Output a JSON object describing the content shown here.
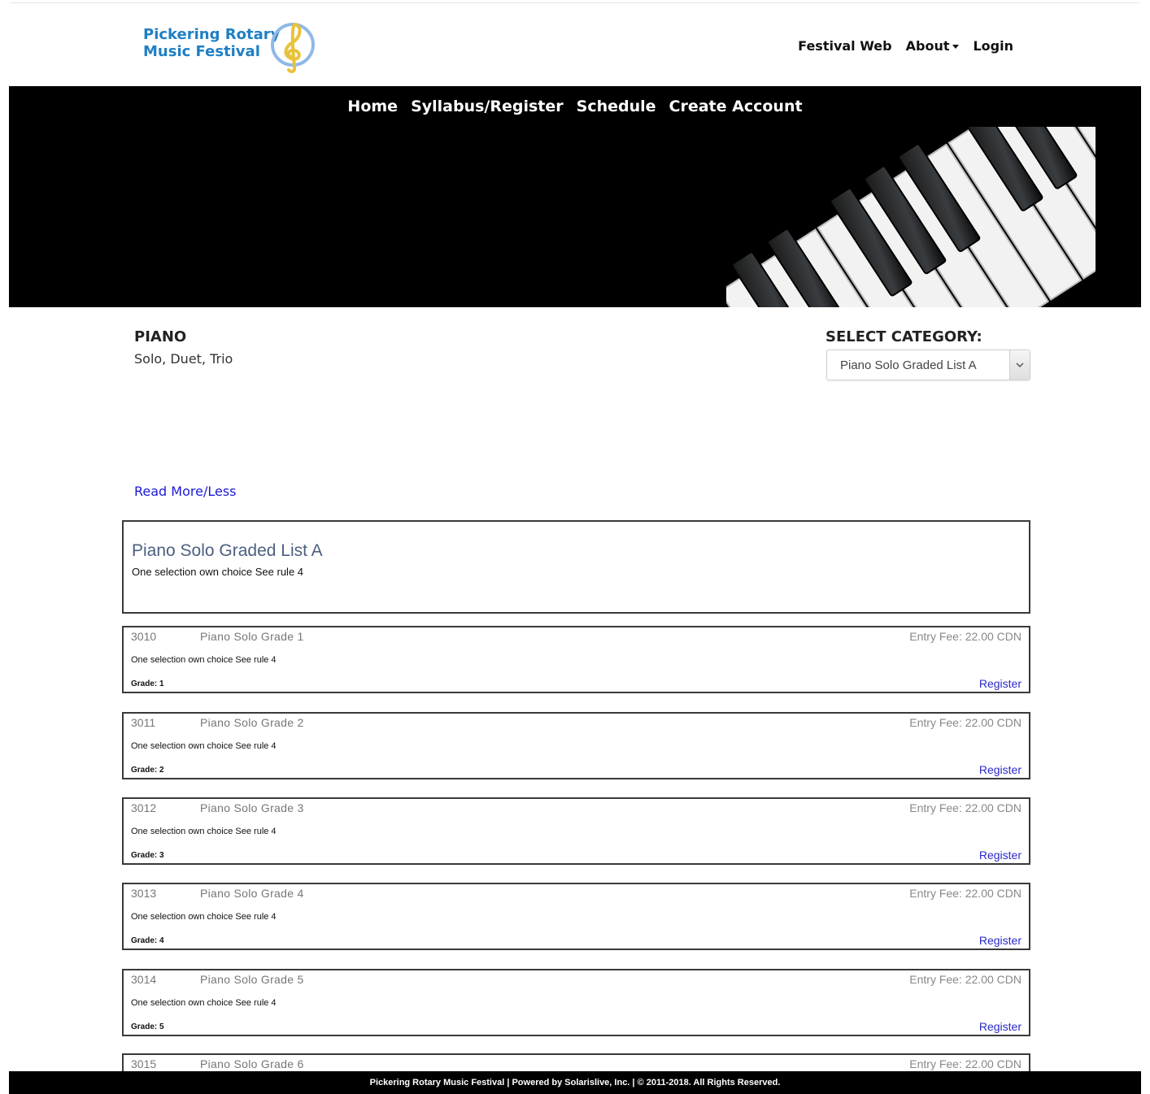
{
  "header": {
    "logo_line1": "Pickering Rotary",
    "logo_line2": "Music Festival",
    "nav": [
      {
        "label": "Festival Web"
      },
      {
        "label": "About"
      },
      {
        "label": "Login"
      }
    ]
  },
  "main_nav": [
    {
      "label": "Home"
    },
    {
      "label": "Syllabus/Register"
    },
    {
      "label": "Schedule"
    },
    {
      "label": "Create Account"
    }
  ],
  "section": {
    "title": "PIANO",
    "subtitle": "Solo, Duet, Trio",
    "select_label": "SELECT CATEGORY:",
    "selected_category": "Piano Solo Graded List A",
    "read_more": "Read More/Less"
  },
  "category": {
    "title": "Piano Solo Graded List A",
    "description": "One selection own choice See rule 4"
  },
  "entries": [
    {
      "code": "3010",
      "name": "Piano Solo Grade 1",
      "fee": "Entry Fee: 22.00 CDN",
      "description": "One selection own choice See rule 4",
      "grade": "Grade: 1",
      "action": "Register"
    },
    {
      "code": "3011",
      "name": "Piano Solo Grade 2",
      "fee": "Entry Fee: 22.00 CDN",
      "description": "One selection own choice See rule 4",
      "grade": "Grade: 2",
      "action": "Register"
    },
    {
      "code": "3012",
      "name": "Piano Solo Grade 3",
      "fee": "Entry Fee: 22.00 CDN",
      "description": "One selection own choice See rule 4",
      "grade": "Grade: 3",
      "action": "Register"
    },
    {
      "code": "3013",
      "name": "Piano Solo Grade 4",
      "fee": "Entry Fee: 22.00 CDN",
      "description": "One selection own choice See rule 4",
      "grade": "Grade: 4",
      "action": "Register"
    },
    {
      "code": "3014",
      "name": "Piano Solo Grade 5",
      "fee": "Entry Fee: 22.00 CDN",
      "description": "One selection own choice See rule 4",
      "grade": "Grade: 5",
      "action": "Register"
    },
    {
      "code": "3015",
      "name": "Piano Solo Grade 6",
      "fee": "Entry Fee: 22.00 CDN",
      "description": "",
      "grade": "",
      "action": ""
    }
  ],
  "footer": {
    "text": "Pickering Rotary Music Festival | Powered by Solarislive, Inc. | © 2011-2018. All Rights Reserved."
  },
  "colors": {
    "logo_blue": "#1f7fc4",
    "link_blue": "#1a1ad4",
    "banner_black": "#000000",
    "category_title": "#4b5f80"
  }
}
